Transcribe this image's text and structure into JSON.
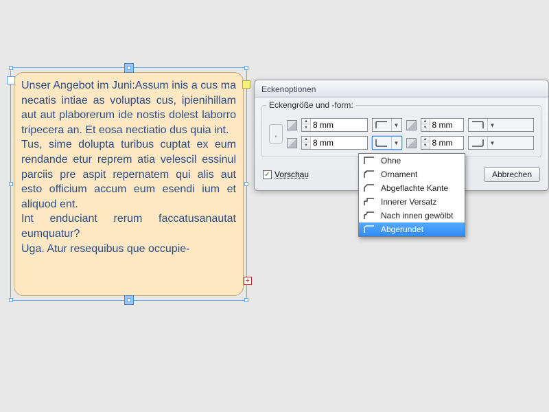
{
  "textframe": {
    "paragraphs": [
      "Unser Angebot im Juni:Assum inis a cus ma necatis intiae as voluptas cus, ipienihillam aut aut plaborerum ide nostis dolest laborro tripecera an. Et eosa nectiatio dus quia int.",
      "Tus, sime dolupta turibus cuptat ex eum rendande etur reprem atia velescil essinul parciis pre aspit repernatem qui alis aut esto officium accum eum esendi ium et aliquod ent.",
      "Int enduciant rerum faccatusanautat eumquatur?",
      " Uga. Atur resequibus que occupie-"
    ],
    "overset_glyph": "+"
  },
  "dialog": {
    "title": "Eckenoptionen",
    "group_label": "Eckengröße und -form:",
    "corners": [
      {
        "pos": "tl",
        "size": "8 mm"
      },
      {
        "pos": "tr",
        "size": "8 mm"
      },
      {
        "pos": "bl",
        "size": "8 mm"
      },
      {
        "pos": "br",
        "size": "8 mm"
      }
    ],
    "preview_label": "Vorschau",
    "preview_checked": "✓",
    "cancel_label": "Abbrechen"
  },
  "dropdown": {
    "items": [
      "Ohne",
      "Ornament",
      "Abgeflachte Kante",
      "Innerer Versatz",
      "Nach innen gewölbt",
      "Abgerundet"
    ],
    "selected_index": 5
  }
}
